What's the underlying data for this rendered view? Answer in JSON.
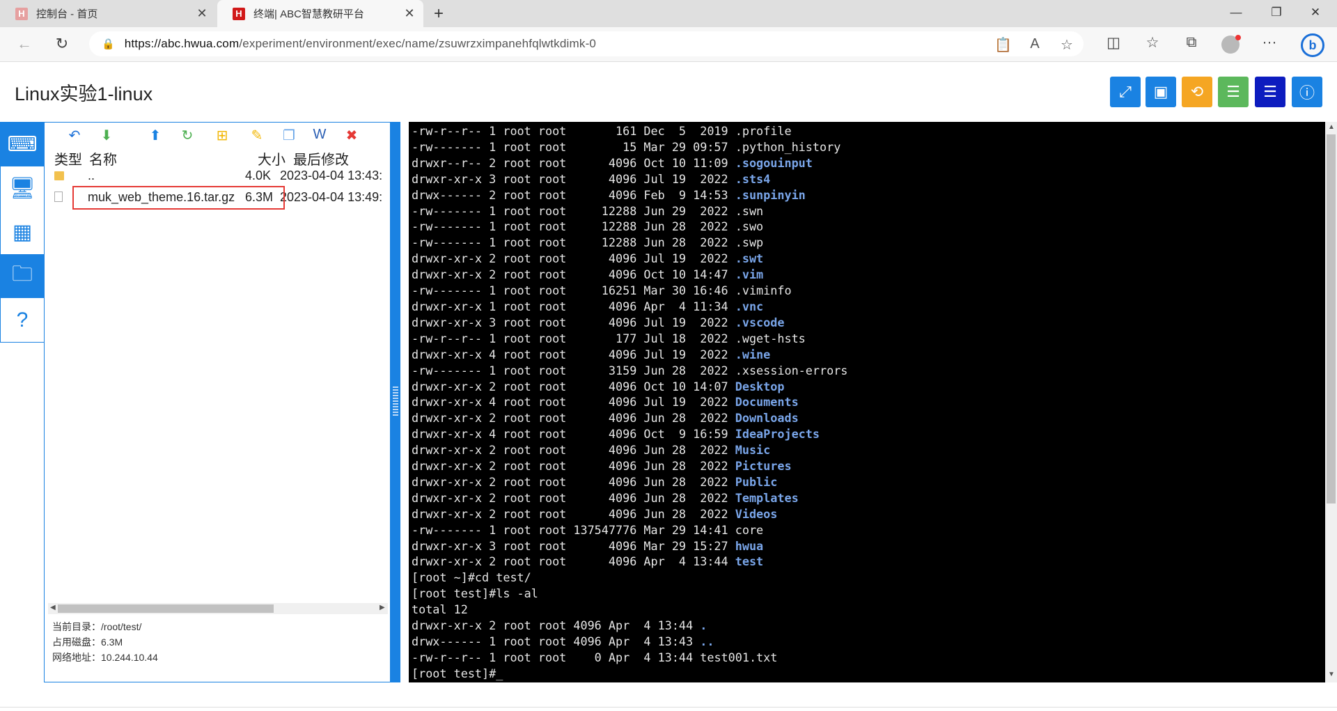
{
  "browser": {
    "tabs": [
      {
        "title": "控制台 - 首页",
        "icon": "hwua-logo"
      },
      {
        "title": "终端| ABC智慧教研平台",
        "icon": "hwua-logo",
        "active": true
      }
    ],
    "url_host": "https://abc.hwua.com",
    "url_path": "/experiment/environment/exec/name/zsuwrzximpanehfqlwtkdimk-0"
  },
  "page": {
    "title": "Linux实验1-linux"
  },
  "toolbar_colors": [
    "#1a82e2",
    "#1a82e2",
    "#f5a623",
    "#5cb85c",
    "#0d1cbf",
    "#1a82e2"
  ],
  "file_manager": {
    "headers": {
      "type": "类型",
      "name": "名称",
      "size": "大小",
      "modified": "最后修改"
    },
    "rows": [
      {
        "type": "folder",
        "name": "..",
        "size": "4.0K",
        "modified": "2023-04-04 13:43:"
      },
      {
        "type": "file",
        "name": "muk_web_theme.16.tar.gz",
        "size": "6.3M",
        "modified": "2023-04-04 13:49:"
      }
    ],
    "info": {
      "cwd_label": "当前目录：",
      "cwd": "/root/test/",
      "disk_label": "占用磁盘：",
      "disk": "6.3M",
      "ip_label": "网络地址：",
      "ip": "10.244.10.44"
    }
  },
  "terminal": {
    "lines": [
      {
        "text": "-rw-r--r-- 1 root root       161 Dec  5  2019 ",
        "name": ".profile",
        "dir": false
      },
      {
        "text": "-rw------- 1 root root        15 Mar 29 09:57 ",
        "name": ".python_history",
        "dir": false
      },
      {
        "text": "drwxr--r-- 2 root root      4096 Oct 10 11:09 ",
        "name": ".sogouinput",
        "dir": true
      },
      {
        "text": "drwxr-xr-x 3 root root      4096 Jul 19  2022 ",
        "name": ".sts4",
        "dir": true
      },
      {
        "text": "drwx------ 2 root root      4096 Feb  9 14:53 ",
        "name": ".sunpinyin",
        "dir": true
      },
      {
        "text": "-rw------- 1 root root     12288 Jun 29  2022 ",
        "name": ".swn",
        "dir": false
      },
      {
        "text": "-rw------- 1 root root     12288 Jun 28  2022 ",
        "name": ".swo",
        "dir": false
      },
      {
        "text": "-rw------- 1 root root     12288 Jun 28  2022 ",
        "name": ".swp",
        "dir": false
      },
      {
        "text": "drwxr-xr-x 2 root root      4096 Jul 19  2022 ",
        "name": ".swt",
        "dir": true
      },
      {
        "text": "drwxr-xr-x 2 root root      4096 Oct 10 14:47 ",
        "name": ".vim",
        "dir": true
      },
      {
        "text": "-rw------- 1 root root     16251 Mar 30 16:46 ",
        "name": ".viminfo",
        "dir": false
      },
      {
        "text": "drwxr-xr-x 1 root root      4096 Apr  4 11:34 ",
        "name": ".vnc",
        "dir": true
      },
      {
        "text": "drwxr-xr-x 3 root root      4096 Jul 19  2022 ",
        "name": ".vscode",
        "dir": true
      },
      {
        "text": "-rw-r--r-- 1 root root       177 Jul 18  2022 ",
        "name": ".wget-hsts",
        "dir": false
      },
      {
        "text": "drwxr-xr-x 4 root root      4096 Jul 19  2022 ",
        "name": ".wine",
        "dir": true
      },
      {
        "text": "-rw------- 1 root root      3159 Jun 28  2022 ",
        "name": ".xsession-errors",
        "dir": false
      },
      {
        "text": "drwxr-xr-x 2 root root      4096 Oct 10 14:07 ",
        "name": "Desktop",
        "dir": true
      },
      {
        "text": "drwxr-xr-x 4 root root      4096 Jul 19  2022 ",
        "name": "Documents",
        "dir": true
      },
      {
        "text": "drwxr-xr-x 2 root root      4096 Jun 28  2022 ",
        "name": "Downloads",
        "dir": true
      },
      {
        "text": "drwxr-xr-x 4 root root      4096 Oct  9 16:59 ",
        "name": "IdeaProjects",
        "dir": true
      },
      {
        "text": "drwxr-xr-x 2 root root      4096 Jun 28  2022 ",
        "name": "Music",
        "dir": true
      },
      {
        "text": "drwxr-xr-x 2 root root      4096 Jun 28  2022 ",
        "name": "Pictures",
        "dir": true
      },
      {
        "text": "drwxr-xr-x 2 root root      4096 Jun 28  2022 ",
        "name": "Public",
        "dir": true
      },
      {
        "text": "drwxr-xr-x 2 root root      4096 Jun 28  2022 ",
        "name": "Templates",
        "dir": true
      },
      {
        "text": "drwxr-xr-x 2 root root      4096 Jun 28  2022 ",
        "name": "Videos",
        "dir": true
      },
      {
        "text": "-rw------- 1 root root 137547776 Mar 29 14:41 ",
        "name": "core",
        "dir": false
      },
      {
        "text": "drwxr-xr-x 3 root root      4096 Mar 29 15:27 ",
        "name": "hwua",
        "dir": true
      },
      {
        "text": "drwxr-xr-x 2 root root      4096 Apr  4 13:44 ",
        "name": "test",
        "dir": true
      },
      {
        "text": "[root ~]#cd test/",
        "name": "",
        "dir": false
      },
      {
        "text": "[root test]#ls -al",
        "name": "",
        "dir": false
      },
      {
        "text": "total 12",
        "name": "",
        "dir": false
      },
      {
        "text": "drwxr-xr-x 2 root root 4096 Apr  4 13:44 ",
        "name": ".",
        "dir": true
      },
      {
        "text": "drwx------ 1 root root 4096 Apr  4 13:43 ",
        "name": "..",
        "dir": true
      },
      {
        "text": "-rw-r--r-- 1 root root    0 Apr  4 13:44 ",
        "name": "test001.txt",
        "dir": false
      },
      {
        "text": "[root test]#_",
        "name": "",
        "dir": false
      }
    ]
  }
}
